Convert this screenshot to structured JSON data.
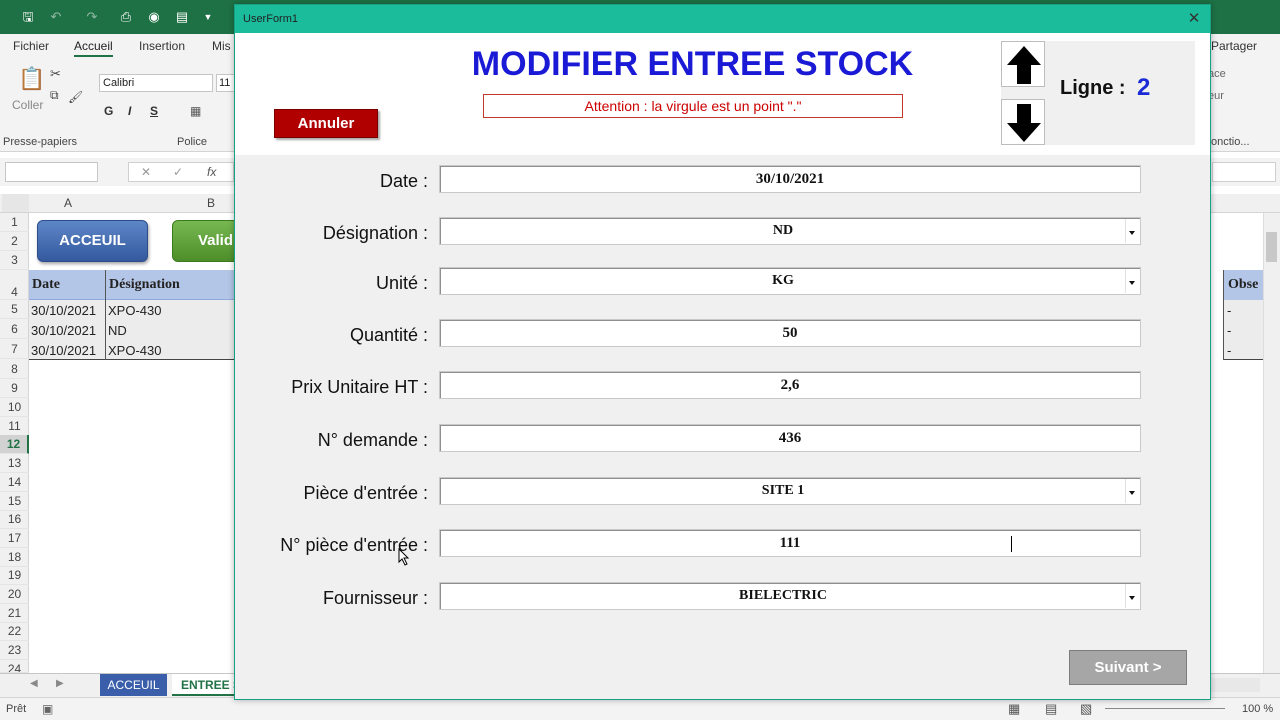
{
  "excel": {
    "ribbon_tabs": [
      "Fichier",
      "Accueil",
      "Insertion",
      "Mis",
      "Partager"
    ],
    "font_name": "Calibri",
    "font_size": "11",
    "format_buttons": [
      "G",
      "I",
      "S"
    ],
    "paste_label": "Coller",
    "groups": {
      "clipboard": "Presse-papiers",
      "font": "Police"
    },
    "right_ribbon": [
      "ace",
      "eur",
      "onctio..."
    ],
    "fx_label": "fx",
    "column_headers": [
      "A",
      "B"
    ],
    "row_headers": [
      "1",
      "2",
      "3",
      "4",
      "5",
      "6",
      "7",
      "8",
      "9",
      "10",
      "11",
      "12",
      "13",
      "14",
      "15",
      "16",
      "17",
      "18",
      "19",
      "20",
      "21",
      "22",
      "23",
      "24"
    ],
    "buttons": {
      "acceuil": "ACCEUIL",
      "valid": "Valid"
    },
    "table": {
      "headers": [
        "Date",
        "Désignation"
      ],
      "rows": [
        [
          "30/10/2021",
          "XPO-430"
        ],
        [
          "30/10/2021",
          "ND"
        ],
        [
          "30/10/2021",
          "XPO-430"
        ]
      ],
      "right_header": "Obse",
      "right_values": [
        "-",
        "-",
        "-"
      ]
    },
    "sheet_tabs": [
      "ACCEUIL",
      "ENTREE S"
    ],
    "status": "Prêt",
    "zoom": "100 %"
  },
  "userform": {
    "title": "UserForm1",
    "heading": "MODIFIER ENTREE STOCK",
    "cancel_label": "Annuler",
    "warning": "Attention : la virgule est un point \".\"",
    "ligne_label": "Ligne :",
    "ligne_value": "2",
    "fields": {
      "date": {
        "label": "Date :",
        "value": "30/10/2021"
      },
      "designation": {
        "label": "Désignation :",
        "value": "ND"
      },
      "unite": {
        "label": "Unité :",
        "value": "KG"
      },
      "quantite": {
        "label": "Quantité :",
        "value": "50"
      },
      "prix": {
        "label": "Prix Unitaire HT :",
        "value": "2,6"
      },
      "demande": {
        "label": "N° demande :",
        "value": "436"
      },
      "piece": {
        "label": "Pièce d'entrée :",
        "value": "SITE 1"
      },
      "num_piece": {
        "label": "N° pièce d'entrée :",
        "value": "111"
      },
      "fournisseur": {
        "label": "Fournisseur :",
        "value": "BIELECTRIC"
      }
    },
    "next_label": "Suivant  >"
  }
}
